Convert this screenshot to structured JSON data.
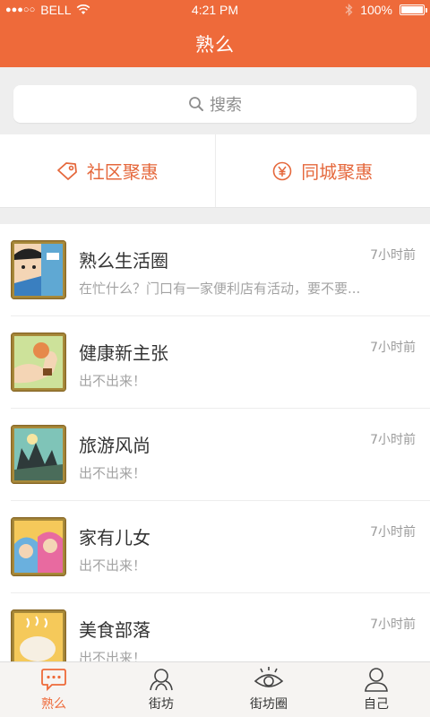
{
  "status_bar": {
    "carrier": "BELL",
    "signal_dots": "●●●○○",
    "time": "4:21 PM",
    "battery": "100%"
  },
  "header": {
    "title": "熟么"
  },
  "search": {
    "placeholder": "搜索"
  },
  "deals": [
    {
      "label": "社区聚惠",
      "icon": "tag-icon"
    },
    {
      "label": "同城聚惠",
      "icon": "yen-icon"
    }
  ],
  "groups": [
    {
      "name": "熟么生活圈",
      "time": "7小时前",
      "desc": "在忙什么？门口有一家便利店有活动，要不要..."
    },
    {
      "name": "健康新主张",
      "time": "7小时前",
      "desc": "出不出来！"
    },
    {
      "name": "旅游风尚",
      "time": "7小时前",
      "desc": "出不出来！"
    },
    {
      "name": "家有儿女",
      "time": "7小时前",
      "desc": "出不出来！"
    },
    {
      "name": "美食部落",
      "time": "7小时前",
      "desc": "出不出来！"
    }
  ],
  "tabbar": [
    {
      "label": "熟么",
      "icon": "chat-icon",
      "active": true
    },
    {
      "label": "街坊",
      "icon": "neighbors-icon"
    },
    {
      "label": "街坊圈",
      "icon": "eye-icon"
    },
    {
      "label": "自己",
      "icon": "person-icon"
    }
  ],
  "colors": {
    "brand": "#ee6a3a",
    "background": "#eeeeee"
  }
}
